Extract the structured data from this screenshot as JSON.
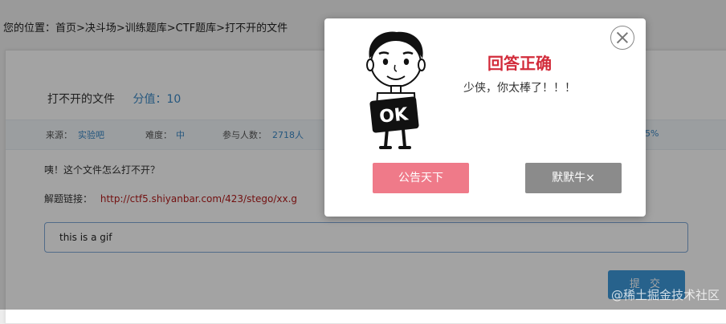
{
  "breadcrumb": "您的位置：首页>决斗场>训练题库>CTF题库>打不开的文件",
  "challenge": {
    "title": "打不开的文件",
    "score": "分值：10",
    "info": {
      "source_label": "来源：",
      "source_value": "实验吧",
      "difficulty_label": "难度：",
      "difficulty_value": "中",
      "participants_label": "参与人数：",
      "participants_value": "2718人",
      "rate_value": "5%"
    },
    "question": "咦！这个文件怎么打不开？",
    "link_label": "解题链接：",
    "link_url": "http://ctf5.shiyanbar.com/423/stego/xx.g",
    "answer_value": "this is a gif",
    "submit_label": "提 交"
  },
  "modal": {
    "title": "回答正确",
    "message": "少侠，你太棒了！！！",
    "share_button": "公告天下",
    "dismiss_button": "默默牛×",
    "mascot_text": "OK"
  },
  "watermark": "@稀土掘金技术社区"
}
